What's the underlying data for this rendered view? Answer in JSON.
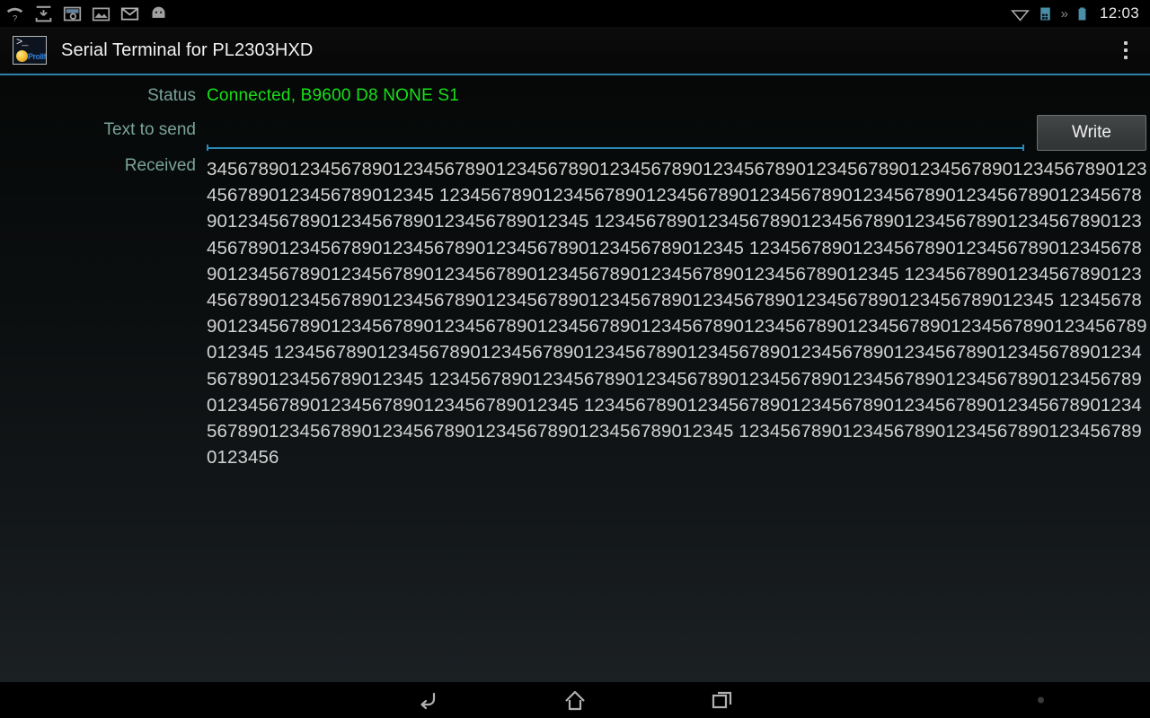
{
  "statusbar": {
    "icons": [
      "wifi-question-icon",
      "download-tray-icon",
      "screenshot-icon",
      "gallery-icon",
      "gmail-icon",
      "android-icon"
    ],
    "right_icons": [
      "wifi-signal-icon",
      "cell-signal-icon",
      "battery-icon"
    ],
    "chevrons": "»",
    "clock": "12:03"
  },
  "actionbar": {
    "app_icon": "serial-terminal-app-icon",
    "icon_prompt": ">_",
    "icon_brand": "Prolific",
    "title": "Serial Terminal for PL2303HXD",
    "overflow_label": "overflow-menu"
  },
  "main": {
    "status_label": "Status",
    "status_value": "Connected, B9600 D8 NONE S1",
    "send_label": "Text to send",
    "send_value": "",
    "send_placeholder": "",
    "write_label": "Write",
    "received_label": "Received",
    "received_text": "34567890123456789012345678901234567890123456789012345678901234567890123456789012345678901234567890123456789012345 123456789012345678901234567890123456789012345678901234567890123456789012345678901234567890123456789012345 123456789012345678901234567890123456789012345678901234567890123456789012345678901234567890123456789012345 123456789012345678901234567890123456789012345678901234567890123456789012345678901234567890123456789012345 123456789012345678901234567890123456789012345678901234567890123456789012345678901234567890123456789012345 123456789012345678901234567890123456789012345678901234567890123456789012345678901234567890123456789012345 123456789012345678901234567890123456789012345678901234567890123456789012345678901234567890123456789012345 123456789012345678901234567890123456789012345678901234567890123456789012345678901234567890123456789012345 123456789012345678901234567890123456789012345678901234567890123456789012345678901234567890123456789012345 1234567890123456789012345678901234567890123456"
  },
  "navbar": {
    "back_label": "back-button",
    "home_label": "home-button",
    "recents_label": "recent-apps-button"
  },
  "colors": {
    "accent": "#2f7fa8",
    "status_ok": "#18e018",
    "label": "#79a39a",
    "text": "#d2d2d2"
  }
}
